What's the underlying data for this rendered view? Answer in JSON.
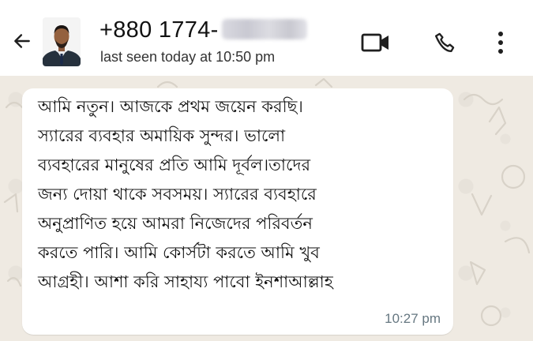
{
  "header": {
    "back_icon": "arrow-left-icon",
    "contact_name": "+880 1774-",
    "contact_name_obscured": true,
    "status": "last seen today at 10:50 pm",
    "actions": [
      {
        "name": "video-call",
        "icon": "video-camera-icon"
      },
      {
        "name": "voice-call",
        "icon": "phone-icon"
      },
      {
        "name": "more-options",
        "icon": "three-dots-vertical-icon"
      }
    ]
  },
  "chat": {
    "background_color": "#efeae2",
    "messages": [
      {
        "direction": "incoming",
        "text": "আমি নতুন। আজকে প্রথম জয়েন করছি।\nস্যারের ব্যবহার অমায়িক সুন্দর। ভালো\nব্যবহারের মানুষের প্রতি আমি দূর্বল।তাদের\nজন্য দোয়া থাকে সবসময়। স্যারের ব্যবহারে\nঅনুপ্রাণিত হয়ে আমরা নিজেদের পরিবর্তন\nকরতে পারি। আমি কোর্সটা করতে আমি খুব\nআগ্রহী। আশা করি সাহায্য পাবো ইনশাআল্লাহ",
        "time": "10:27 pm"
      }
    ]
  },
  "colors": {
    "header_bg": "#ffffff",
    "icon_color": "#1f1f1f",
    "bubble_bg": "#ffffff",
    "timestamp": "#667781"
  }
}
